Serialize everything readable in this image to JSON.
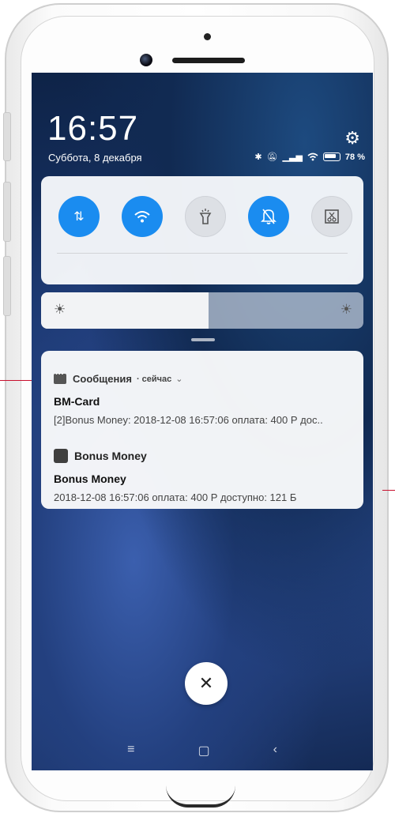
{
  "status_bar": {
    "time": "16:57",
    "date": "Суббота, 8 декабря",
    "battery": "78 %",
    "status_icons": [
      "bluetooth-icon",
      "mute-icon",
      "signal-icon",
      "wifi-icon",
      "battery-icon"
    ]
  },
  "quick_settings": {
    "toggles": [
      {
        "name": "mobile-data",
        "icon": "⇅",
        "state": "on"
      },
      {
        "name": "wifi",
        "icon": "wifi-icon",
        "state": "on"
      },
      {
        "name": "flashlight",
        "icon": "flashlight-icon",
        "state": "off"
      },
      {
        "name": "mute",
        "icon": "mute-icon",
        "state": "on"
      },
      {
        "name": "screenshot",
        "icon": "screenshot-icon",
        "state": "off"
      }
    ],
    "brightness_percent": 52
  },
  "notifications": {
    "group1": {
      "app": "Сообщения",
      "time": "· сейчас",
      "title": "BM-Card",
      "text": "[2]Bonus Money:  2018-12-08 16:57:06 оплата: 400 Р дос.."
    },
    "group2": {
      "app": "Bonus Money",
      "title": "Bonus Money",
      "text": "2018-12-08 16:57:06 оплата: 400 Р доступно: 121 Б"
    }
  },
  "close_label": "✕",
  "nav": {
    "menu": "≡",
    "home": "▢",
    "back": "‹"
  },
  "colors": {
    "accent": "#1a8cf0",
    "callout": "#c8102e"
  }
}
